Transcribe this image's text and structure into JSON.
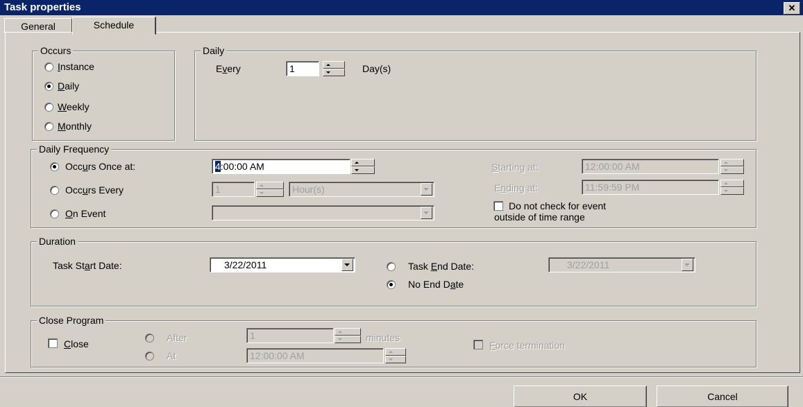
{
  "window": {
    "title": "Task properties",
    "close_glyph": "✕"
  },
  "tabs": [
    {
      "label": "General",
      "active": false
    },
    {
      "label": "Schedule",
      "active": true
    }
  ],
  "occurs": {
    "legend": "Occurs",
    "options": [
      {
        "pre": "",
        "key": "I",
        "post": "nstance",
        "selected": false
      },
      {
        "pre": "",
        "key": "D",
        "post": "aily",
        "selected": true
      },
      {
        "pre": "",
        "key": "W",
        "post": "eekly",
        "selected": false
      },
      {
        "pre": "",
        "key": "M",
        "post": "onthly",
        "selected": false
      }
    ]
  },
  "daily": {
    "legend": "Daily",
    "every_pre": "E",
    "every_key": "v",
    "every_post": "ery",
    "every_value": "1",
    "unit": "Day(s)"
  },
  "daily_frequency": {
    "legend": "Daily Frequency",
    "once": {
      "pre": "Occ",
      "key": "u",
      "post": "rs Once at:",
      "selected": true,
      "value_sel": "4",
      "value_rest": ":00:00 AM"
    },
    "every": {
      "pre": "Occ",
      "key": "u",
      "post": "rs Every",
      "selected": false,
      "value": "1",
      "unit": "Hour(s)"
    },
    "event": {
      "pre": "",
      "key": "O",
      "post": "n Event",
      "selected": false,
      "value": ""
    },
    "starting": {
      "pre": "",
      "key": "S",
      "post": "tarting at:",
      "value": "12:00:00 AM"
    },
    "ending": {
      "pre": "E",
      "key": "n",
      "post": "ding at:",
      "value": "11:59:59 PM"
    },
    "no_check_line1": "Do not check for event",
    "no_check_line2": "outside of time range"
  },
  "duration": {
    "legend": "Duration",
    "start_pre": "Task St",
    "start_key": "a",
    "start_post": "rt Date:",
    "start_value": "3/22/2011",
    "end": {
      "pre": "Task ",
      "key": "E",
      "post": "nd Date:",
      "selected": false,
      "value": "3/22/2011"
    },
    "no_end": {
      "pre": "No End D",
      "key": "a",
      "post": "te",
      "selected": true
    }
  },
  "close_program": {
    "legend": "Close Program",
    "close": {
      "pre": "",
      "key": "C",
      "post": "lose",
      "checked": false
    },
    "after": {
      "label": "After",
      "value": "1",
      "unit": "minutes"
    },
    "at": {
      "label": "At",
      "value": "12:00:00 AM"
    },
    "force": {
      "pre": "",
      "key": "F",
      "post": "orce termination"
    }
  },
  "buttons": {
    "ok": "OK",
    "cancel": "Cancel"
  },
  "colors": {
    "face": "#d4d0c8",
    "title_bar": "#0a246a",
    "disabled_text": "#a0a0a0"
  }
}
